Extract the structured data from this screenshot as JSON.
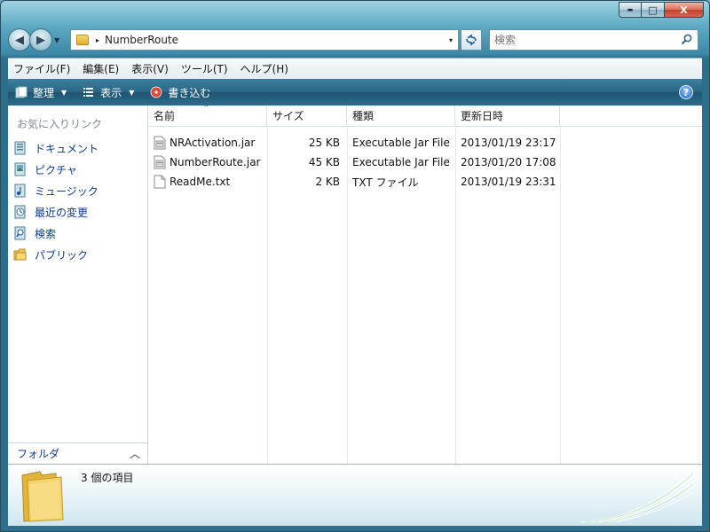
{
  "window": {
    "caption_buttons": {
      "minimize": "▬",
      "maximize": "□",
      "close": "X"
    }
  },
  "address_bar": {
    "path_separator": "▸",
    "current_folder": "NumberRoute",
    "dropdown": "▾",
    "refresh_icon": "refresh-icon"
  },
  "search": {
    "placeholder": "検索"
  },
  "menu": [
    "ファイル(F)",
    "編集(E)",
    "表示(V)",
    "ツール(T)",
    "ヘルプ(H)"
  ],
  "command_bar": {
    "organize": "整理",
    "views": "表示",
    "burn": "書き込む",
    "help": "?"
  },
  "nav_pane": {
    "heading": "お気に入りリンク",
    "items": [
      {
        "label": "ドキュメント",
        "icon": "documents-icon"
      },
      {
        "label": "ピクチャ",
        "icon": "pictures-icon"
      },
      {
        "label": "ミュージック",
        "icon": "music-icon"
      },
      {
        "label": "最近の変更",
        "icon": "recent-changes-icon"
      },
      {
        "label": "検索",
        "icon": "searches-icon"
      },
      {
        "label": "パブリック",
        "icon": "public-folder-icon"
      }
    ],
    "folders_label": "フォルダ",
    "folders_chevron": "︿"
  },
  "file_list": {
    "columns": [
      "名前",
      "サイズ",
      "種類",
      "更新日時"
    ],
    "sort_indicator": "^",
    "files": [
      {
        "name": "NRActivation.jar",
        "size": "25 KB",
        "type": "Executable Jar File",
        "modified": "2013/01/19 23:17",
        "icon": "jar-file-icon"
      },
      {
        "name": "NumberRoute.jar",
        "size": "45 KB",
        "type": "Executable Jar File",
        "modified": "2013/01/20 17:08",
        "icon": "jar-file-icon"
      },
      {
        "name": "ReadMe.txt",
        "size": "2 KB",
        "type": "TXT ファイル",
        "modified": "2013/01/19 23:31",
        "icon": "text-file-icon"
      }
    ]
  },
  "details_pane": {
    "item_count": "3 個の項目"
  }
}
